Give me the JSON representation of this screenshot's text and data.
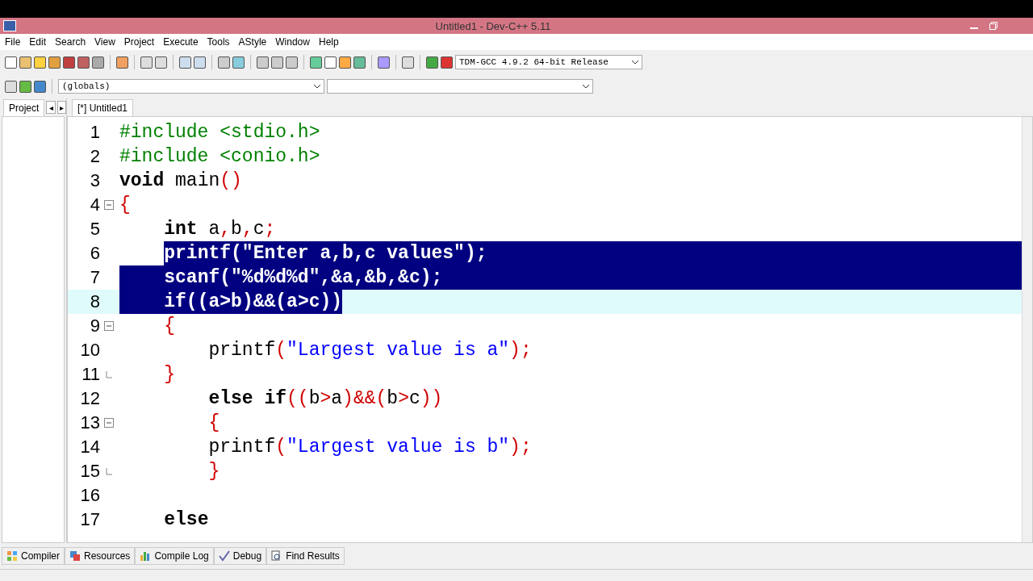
{
  "window": {
    "title": "Untitled1 - Dev-C++ 5.11"
  },
  "menu": [
    "File",
    "Edit",
    "Search",
    "View",
    "Project",
    "Execute",
    "Tools",
    "AStyle",
    "Window",
    "Help"
  ],
  "compiler_select": {
    "value": "TDM-GCC 4.9.2 64-bit Release"
  },
  "scope_select": {
    "value": "(globals)"
  },
  "left_tabs": {
    "label": "Project",
    "prev": "◂",
    "next": "▸"
  },
  "editor_tabs": [
    {
      "label": "[*] Untitled1",
      "selected": true
    }
  ],
  "code_lines": [
    {
      "number": "1",
      "kind": "plain",
      "tokens": [
        {
          "kind": "preproc",
          "text": "#include <stdio.h>"
        }
      ]
    },
    {
      "number": "2",
      "kind": "plain",
      "tokens": [
        {
          "kind": "preproc",
          "text": "#include <conio.h>"
        }
      ]
    },
    {
      "number": "3",
      "kind": "plain",
      "tokens": [
        {
          "kind": "keyword",
          "text": "void"
        },
        {
          "kind": "ident",
          "text": " main"
        },
        {
          "kind": "punct",
          "text": "()"
        }
      ]
    },
    {
      "number": "4",
      "kind": "fold_start",
      "tokens": [
        {
          "kind": "punct",
          "text": "{"
        }
      ]
    },
    {
      "number": "5",
      "kind": "plain",
      "tokens": [
        {
          "kind": "keyword",
          "text": "    int"
        },
        {
          "kind": "ident",
          "text": " a"
        },
        {
          "kind": "punct",
          "text": ","
        },
        {
          "kind": "ident",
          "text": "b"
        },
        {
          "kind": "punct",
          "text": ","
        },
        {
          "kind": "ident",
          "text": "c"
        },
        {
          "kind": "punct",
          "text": ";"
        }
      ]
    },
    {
      "number": "6",
      "kind": "plain",
      "indent_selected": false,
      "eol_selected": true,
      "tokens": [
        {
          "kind": "ident",
          "text": "    printf",
          "selected": true
        },
        {
          "kind": "punct",
          "text": "(",
          "selected": true
        },
        {
          "kind": "string",
          "text": "\"Enter a,b,c values\"",
          "selected": true
        },
        {
          "kind": "punct",
          "text": ");",
          "selected": true
        }
      ]
    },
    {
      "number": "7",
      "kind": "plain",
      "indent_selected": true,
      "eol_selected": true,
      "tokens": [
        {
          "kind": "ident",
          "text": "    scanf",
          "selected": true
        },
        {
          "kind": "punct",
          "text": "(",
          "selected": true
        },
        {
          "kind": "string",
          "text": "\"%d%d%d\"",
          "selected": true
        },
        {
          "kind": "punct",
          "text": ",&",
          "selected": true
        },
        {
          "kind": "ident",
          "text": "a",
          "selected": true
        },
        {
          "kind": "punct",
          "text": ",&",
          "selected": true
        },
        {
          "kind": "ident",
          "text": "b",
          "selected": true
        },
        {
          "kind": "punct",
          "text": ",&",
          "selected": true
        },
        {
          "kind": "ident",
          "text": "c",
          "selected": true
        },
        {
          "kind": "punct",
          "text": ");",
          "selected": true
        }
      ]
    },
    {
      "number": "8",
      "kind": "plain",
      "current": true,
      "indent_selected": true,
      "tokens": [
        {
          "kind": "keyword",
          "text": "    if",
          "selected": true
        },
        {
          "kind": "punct",
          "text": "((",
          "selected": true
        },
        {
          "kind": "ident",
          "text": "a",
          "selected": true
        },
        {
          "kind": "punct",
          "text": ">",
          "selected": true
        },
        {
          "kind": "ident",
          "text": "b",
          "selected": true
        },
        {
          "kind": "punct",
          "text": ")&&(",
          "selected": true
        },
        {
          "kind": "ident",
          "text": "a",
          "selected": true
        },
        {
          "kind": "punct",
          "text": ">",
          "selected": true
        },
        {
          "kind": "ident",
          "text": "c",
          "selected": true
        },
        {
          "kind": "punct",
          "text": "))",
          "selected": true
        }
      ]
    },
    {
      "number": "9",
      "kind": "fold_start",
      "tokens": [
        {
          "kind": "punct",
          "text": "    {"
        }
      ]
    },
    {
      "number": "10",
      "kind": "plain",
      "tokens": [
        {
          "kind": "ident",
          "text": "        printf"
        },
        {
          "kind": "punct",
          "text": "("
        },
        {
          "kind": "string",
          "text": "\"Largest value is a\""
        },
        {
          "kind": "punct",
          "text": ");"
        }
      ]
    },
    {
      "number": "11",
      "kind": "fold_end",
      "tokens": [
        {
          "kind": "punct",
          "text": "    }"
        }
      ]
    },
    {
      "number": "12",
      "kind": "plain",
      "tokens": [
        {
          "kind": "keyword",
          "text": "        else if"
        },
        {
          "kind": "punct",
          "text": "(("
        },
        {
          "kind": "ident",
          "text": "b"
        },
        {
          "kind": "punct",
          "text": ">"
        },
        {
          "kind": "ident",
          "text": "a"
        },
        {
          "kind": "punct",
          "text": ")&&("
        },
        {
          "kind": "ident",
          "text": "b"
        },
        {
          "kind": "punct",
          "text": ">"
        },
        {
          "kind": "ident",
          "text": "c"
        },
        {
          "kind": "punct",
          "text": "))"
        }
      ]
    },
    {
      "number": "13",
      "kind": "fold_start",
      "tokens": [
        {
          "kind": "punct",
          "text": "        {"
        }
      ]
    },
    {
      "number": "14",
      "kind": "plain",
      "tokens": [
        {
          "kind": "ident",
          "text": "        printf"
        },
        {
          "kind": "punct",
          "text": "("
        },
        {
          "kind": "string",
          "text": "\"Largest value is b\""
        },
        {
          "kind": "punct",
          "text": ");"
        }
      ]
    },
    {
      "number": "15",
      "kind": "fold_end",
      "tokens": [
        {
          "kind": "punct",
          "text": "        }"
        }
      ]
    },
    {
      "number": "16",
      "kind": "plain"
    },
    {
      "number": "17",
      "kind": "plain",
      "tokens": [
        {
          "kind": "keyword",
          "text": "    else"
        }
      ]
    }
  ],
  "bottom_tabs": [
    {
      "label": "Compiler"
    },
    {
      "label": "Resources"
    },
    {
      "label": "Compile Log"
    },
    {
      "label": "Debug"
    },
    {
      "label": "Find Results"
    }
  ]
}
